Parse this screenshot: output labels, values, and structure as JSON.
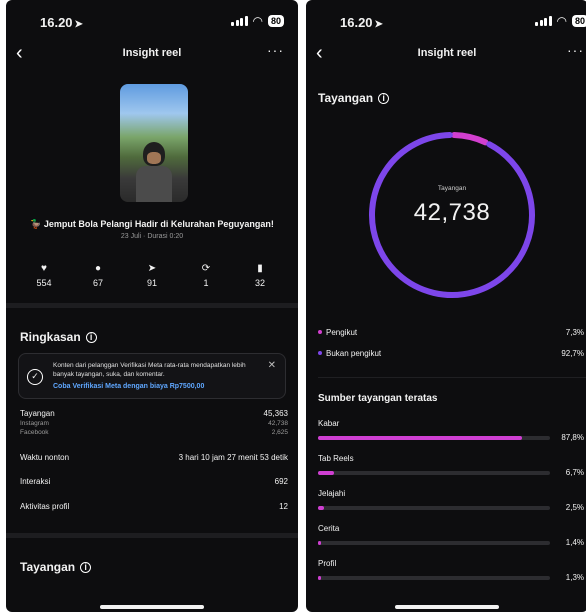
{
  "left": {
    "status": {
      "time": "16.20",
      "battery": "80"
    },
    "nav": {
      "title": "Insight reel"
    },
    "reel": {
      "title": "🦆 Jemput Bola Pelangi Hadir di Kelurahan Peguyangan!",
      "meta": "23 Juli · Durasi 0:20"
    },
    "stats": [
      {
        "icon": "heart-icon",
        "glyph": "♥",
        "value": "554"
      },
      {
        "icon": "comment-icon",
        "glyph": "●",
        "value": "67"
      },
      {
        "icon": "share-icon",
        "glyph": "➤",
        "value": "91"
      },
      {
        "icon": "repost-icon",
        "glyph": "⟳",
        "value": "1"
      },
      {
        "icon": "bookmark-icon",
        "glyph": "▮",
        "value": "32"
      }
    ],
    "summary": {
      "heading": "Ringkasan",
      "notice_text": "Konten dari pelanggan Verifikasi Meta rata-rata mendapatkan lebih banyak tayangan, suka, dan komentar.",
      "notice_link": "Coba Verifikasi Meta dengan biaya Rp7500,00",
      "rows": {
        "views_label": "Tayangan",
        "views_value": "45,363",
        "instagram_label": "Instagram",
        "instagram_value": "42,738",
        "facebook_label": "Facebook",
        "facebook_value": "2,625",
        "watch_label": "Waktu nonton",
        "watch_value": "3 hari 10 jam 27 menit 53 detik",
        "interactions_label": "Interaksi",
        "interactions_value": "692",
        "profile_label": "Aktivitas profil",
        "profile_value": "12"
      }
    },
    "views_heading": "Tayangan"
  },
  "right": {
    "status": {
      "time": "16.20",
      "battery": "80"
    },
    "nav": {
      "title": "Insight reel"
    },
    "heading": "Tayangan",
    "donut": {
      "label": "Tayangan",
      "value": "42,738"
    },
    "legend": [
      {
        "label": "Pengikut",
        "value": "7,3%"
      },
      {
        "label": "Bukan pengikut",
        "value": "92,7%"
      }
    ],
    "sources_heading": "Sumber tayangan teratas",
    "sources": [
      {
        "label": "Kabar",
        "value": "87,8%"
      },
      {
        "label": "Tab Reels",
        "value": "6,7%"
      },
      {
        "label": "Jelajahi",
        "value": "2,5%"
      },
      {
        "label": "Cerita",
        "value": "1,4%"
      },
      {
        "label": "Profil",
        "value": "1,3%"
      }
    ]
  },
  "chart_data": [
    {
      "type": "pie",
      "title": "Tayangan",
      "center_label": "Tayangan",
      "center_value": 42738,
      "categories": [
        "Pengikut",
        "Bukan pengikut"
      ],
      "values": [
        7.3,
        92.7
      ],
      "colors": [
        "#d23fcf",
        "#7d46ea"
      ]
    },
    {
      "type": "bar",
      "title": "Sumber tayangan teratas",
      "categories": [
        "Kabar",
        "Tab Reels",
        "Jelajahi",
        "Cerita",
        "Profil"
      ],
      "values": [
        87.8,
        6.7,
        2.5,
        1.4,
        1.3
      ],
      "colors": [
        "#cf3fd2"
      ]
    }
  ]
}
